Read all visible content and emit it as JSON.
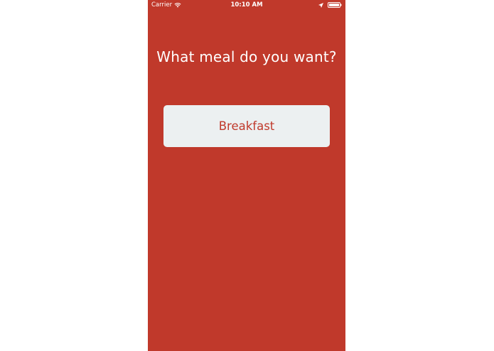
{
  "status_bar": {
    "carrier": "Carrier",
    "time": "10:10 AM",
    "wifi_icon": "wifi-icon",
    "location_icon": "location-arrow-icon",
    "battery_icon": "battery-icon"
  },
  "main": {
    "title": "What meal do you want?",
    "meal_button_label": "Breakfast"
  },
  "colors": {
    "background": "#c0392b",
    "button_background": "#ecf0f1",
    "button_text": "#c0392b",
    "title_text": "#ffffff"
  }
}
